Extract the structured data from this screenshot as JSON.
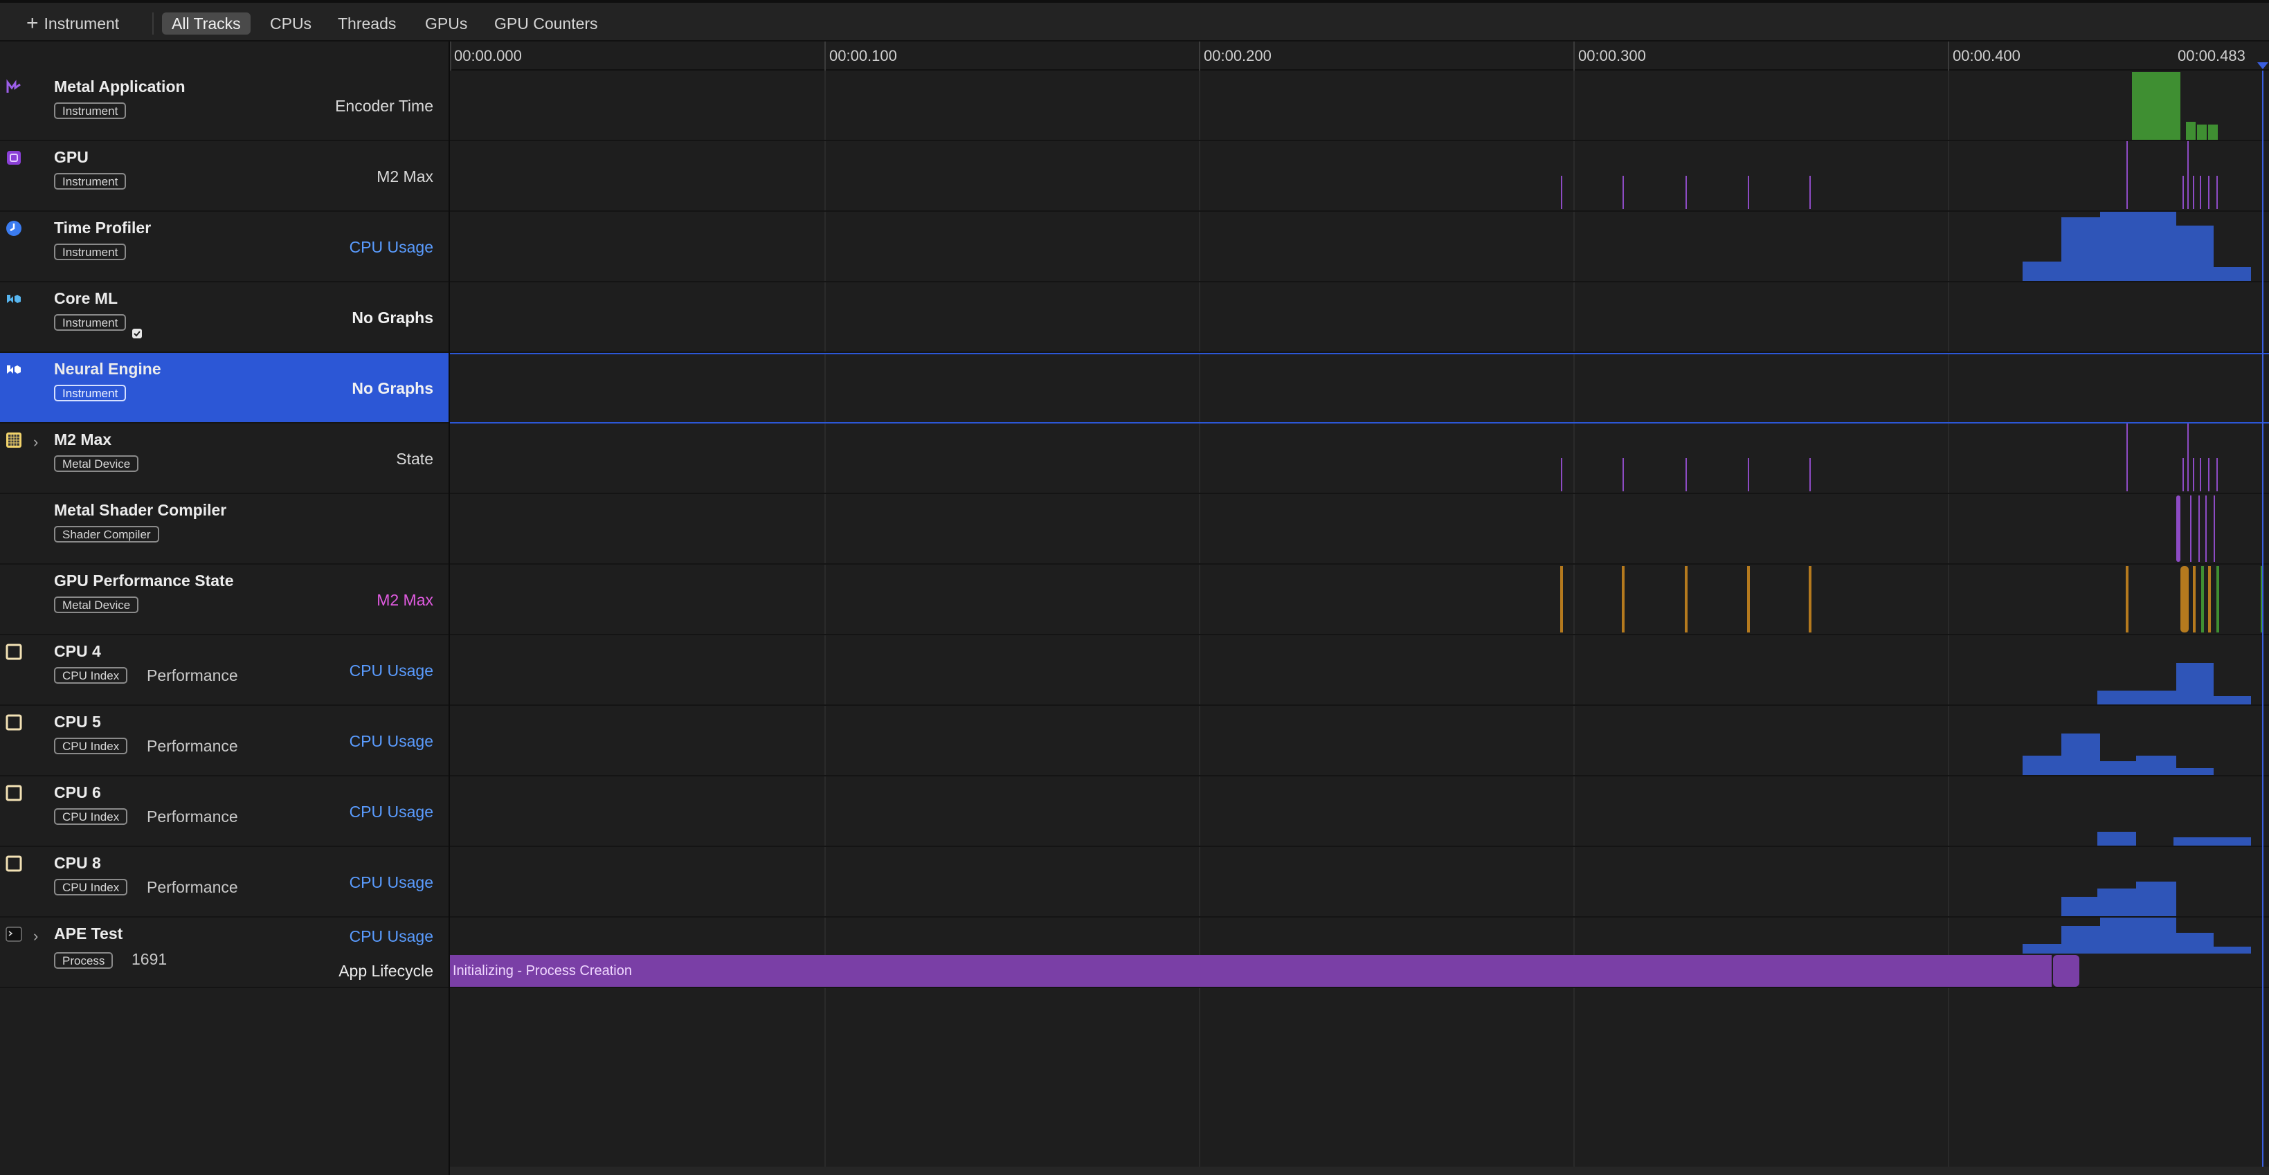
{
  "toolbar": {
    "add_label": "Instrument",
    "tabs": [
      {
        "label": "All Tracks",
        "active": true
      },
      {
        "label": "CPUs",
        "active": false
      },
      {
        "label": "Threads",
        "active": false
      },
      {
        "label": "GPUs",
        "active": false
      },
      {
        "label": "GPU Counters",
        "active": false
      }
    ]
  },
  "ruler": {
    "ticks": [
      "00:00.000",
      "00:00.100",
      "00:00.200",
      "00:00.300",
      "00:00.400",
      "00:00.483"
    ]
  },
  "tracks": [
    {
      "title": "Metal Application",
      "tag": "Instrument",
      "graph": "Encoder Time",
      "icon": "metal-application-icon",
      "graph_style": "plain"
    },
    {
      "title": "GPU",
      "tag": "Instrument",
      "graph": "M2 Max",
      "icon": "gpu-icon",
      "graph_style": "plain"
    },
    {
      "title": "Time Profiler",
      "tag": "Instrument",
      "graph": "CPU Usage",
      "icon": "time-profiler-icon",
      "graph_style": "blue"
    },
    {
      "title": "Core ML",
      "tag": "Instrument",
      "graph": "No Graphs",
      "icon": "core-ml-icon",
      "graph_style": "bold"
    },
    {
      "title": "Neural Engine",
      "tag": "Instrument",
      "graph": "No Graphs",
      "icon": "neural-engine-icon",
      "graph_style": "bold",
      "selected": true
    },
    {
      "title": "M2 Max",
      "tag": "Metal Device",
      "graph": "State",
      "icon": "metal-device-icon",
      "graph_style": "plain",
      "expandable": true
    },
    {
      "title": "Metal Shader Compiler",
      "tag": "Shader Compiler",
      "graph": "",
      "icon": "",
      "graph_style": "plain"
    },
    {
      "title": "GPU Performance State",
      "tag": "Metal Device",
      "graph": "M2 Max",
      "icon": "",
      "graph_style": "pink"
    },
    {
      "title": "CPU 4",
      "tag": "CPU Index",
      "sub": "Performance",
      "graph": "CPU Usage",
      "icon": "cpu-core-icon",
      "graph_style": "blue"
    },
    {
      "title": "CPU 5",
      "tag": "CPU Index",
      "sub": "Performance",
      "graph": "CPU Usage",
      "icon": "cpu-core-icon",
      "graph_style": "blue"
    },
    {
      "title": "CPU 6",
      "tag": "CPU Index",
      "sub": "Performance",
      "graph": "CPU Usage",
      "icon": "cpu-core-icon",
      "graph_style": "blue"
    },
    {
      "title": "CPU 8",
      "tag": "CPU Index",
      "sub": "Performance",
      "graph": "CPU Usage",
      "icon": "cpu-core-icon",
      "graph_style": "blue"
    },
    {
      "title": "APE Test",
      "tag": "Process",
      "sub": "1691",
      "graph": "CPU Usage",
      "graph2": "App Lifecycle",
      "icon": "terminal-icon",
      "graph_style": "blue",
      "expandable": true
    }
  ],
  "lifecycle": {
    "label": "Initializing - Process Creation"
  },
  "colors": {
    "selected": "#2c57d6",
    "cpu_usage": "#2f55b8",
    "encoder": "#3f8f32",
    "gpu_ticks": "#8d4bc4",
    "perf_state": "#b57a1e",
    "lifecycle": "#7a3fa6"
  }
}
